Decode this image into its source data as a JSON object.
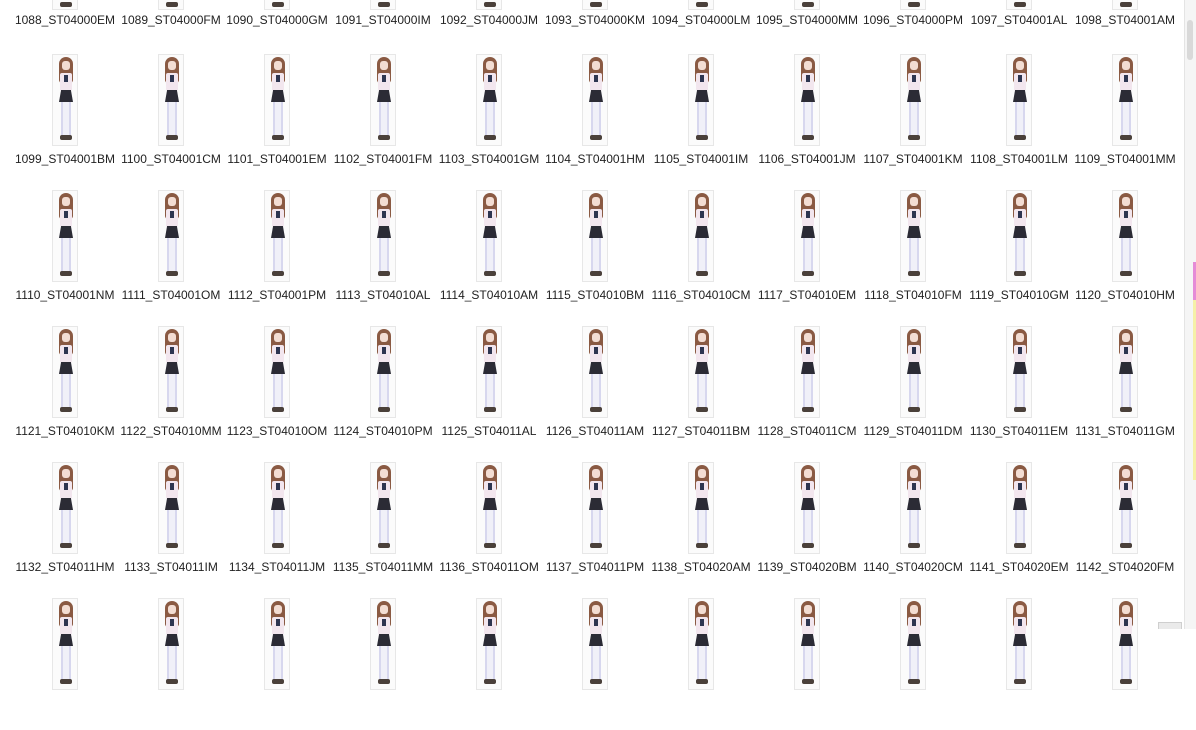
{
  "items": [
    "1088_ST04000EM",
    "1089_ST04000FM",
    "1090_ST04000GM",
    "1091_ST04000IM",
    "1092_ST04000JM",
    "1093_ST04000KM",
    "1094_ST04000LM",
    "1095_ST04000MM",
    "1096_ST04000PM",
    "1097_ST04001AL",
    "1098_ST04001AM",
    "1099_ST04001BM",
    "1100_ST04001CM",
    "1101_ST04001EM",
    "1102_ST04001FM",
    "1103_ST04001GM",
    "1104_ST04001HM",
    "1105_ST04001IM",
    "1106_ST04001JM",
    "1107_ST04001KM",
    "1108_ST04001LM",
    "1109_ST04001MM",
    "1110_ST04001NM",
    "1111_ST04001OM",
    "1112_ST04001PM",
    "1113_ST04010AL",
    "1114_ST04010AM",
    "1115_ST04010BM",
    "1116_ST04010CM",
    "1117_ST04010EM",
    "1118_ST04010FM",
    "1119_ST04010GM",
    "1120_ST04010HM",
    "1121_ST04010KM",
    "1122_ST04010MM",
    "1123_ST04010OM",
    "1124_ST04010PM",
    "1125_ST04011AL",
    "1126_ST04011AM",
    "1127_ST04011BM",
    "1128_ST04011CM",
    "1129_ST04011DM",
    "1130_ST04011EM",
    "1131_ST04011GM",
    "1132_ST04011HM",
    "1133_ST04011IM",
    "1134_ST04011JM",
    "1135_ST04011MM",
    "1136_ST04011OM",
    "1137_ST04011PM",
    "1138_ST04020AM",
    "1139_ST04020BM",
    "1140_ST04020CM",
    "1141_ST04020EM",
    "1142_ST04020FM",
    "",
    "",
    "",
    "",
    "",
    "",
    "",
    "",
    "",
    "",
    ""
  ],
  "icon": "image-thumbnail-icon",
  "colors": {
    "background": "#ffffff",
    "hair": "#8a5a43",
    "uniform_skirt": "#2b2b35",
    "label_text": "#222222"
  }
}
